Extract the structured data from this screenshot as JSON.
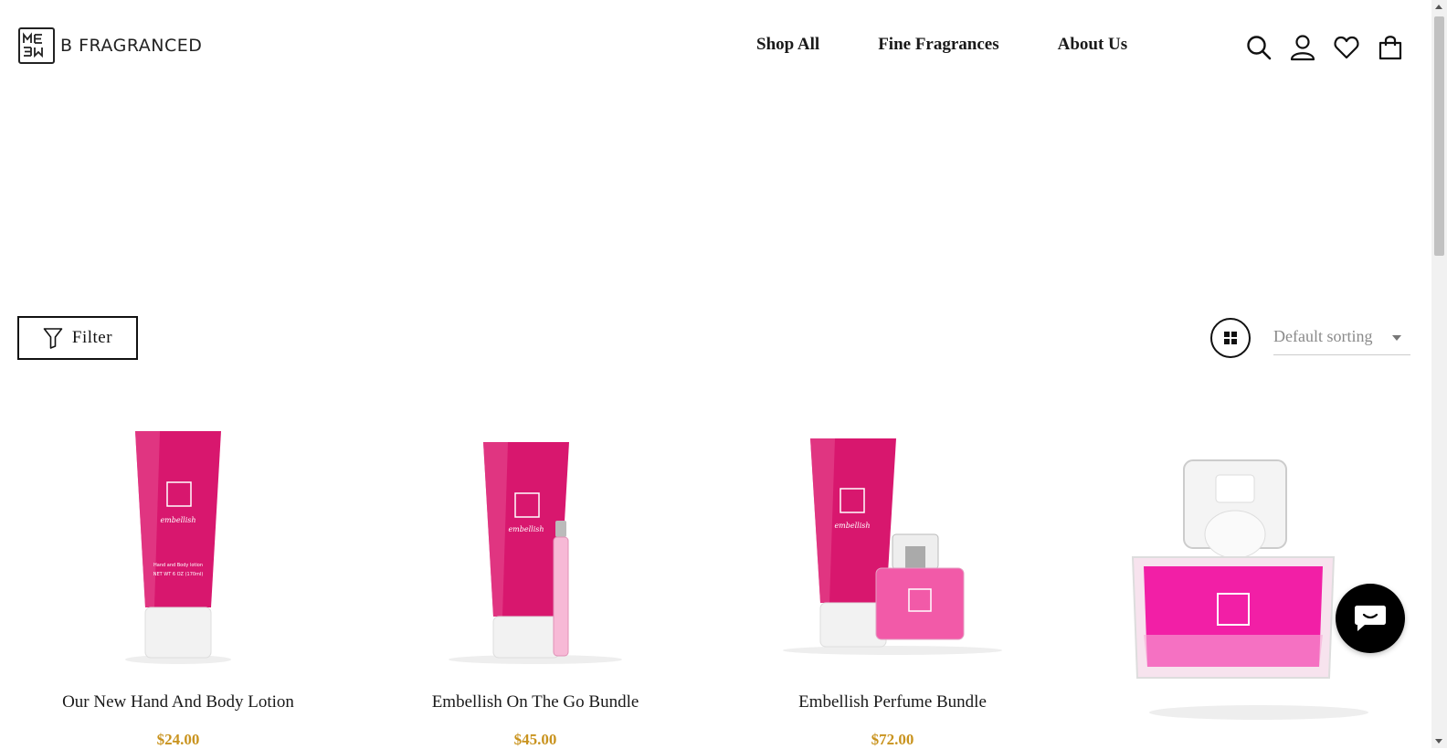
{
  "brand": {
    "name": "B FRAGRANCED",
    "logo_icon": "mebw-monogram-icon"
  },
  "nav": {
    "items": [
      {
        "label": "Shop All"
      },
      {
        "label": "Fine Fragrances"
      },
      {
        "label": "About Us"
      }
    ]
  },
  "header_icons": [
    "search-icon",
    "account-icon",
    "wishlist-heart-icon",
    "cart-bag-icon"
  ],
  "toolbar": {
    "filter_label": "Filter",
    "grid_icon": "grid-view-icon",
    "sort_selected": "Default sorting"
  },
  "products": [
    {
      "name": "Our New Hand And Body Lotion",
      "price": "$24.00"
    },
    {
      "name": "Embellish On The Go Bundle",
      "price": "$45.00"
    },
    {
      "name": "Embellish Perfume Bundle",
      "price": "$72.00"
    },
    {
      "name": "",
      "price": ""
    }
  ],
  "colors": {
    "price": "#c9931e",
    "product_pink": "#d8176e",
    "perfume_pink": "#f21fa6"
  },
  "chat": {
    "icon": "chat-bubble-icon"
  }
}
